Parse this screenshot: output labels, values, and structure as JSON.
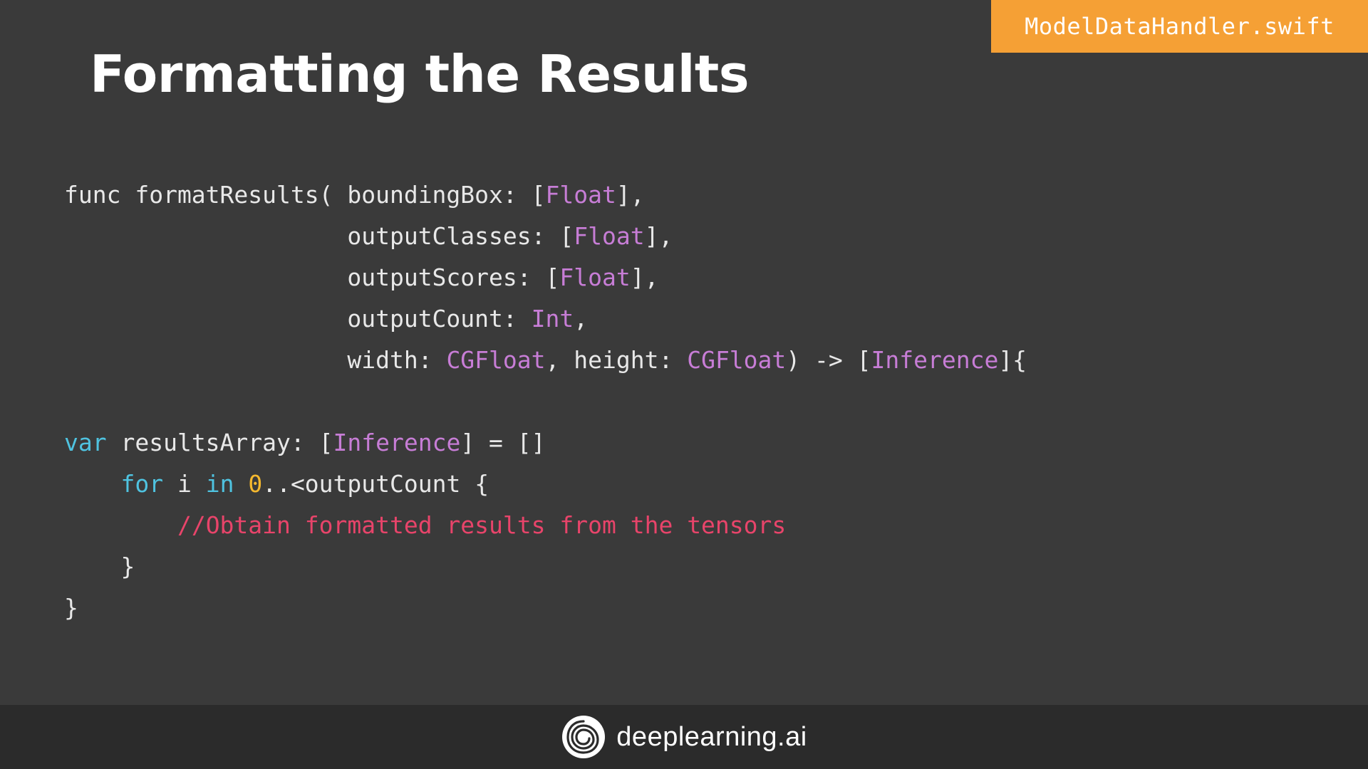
{
  "file_tab": {
    "label": "ModelDataHandler.swift"
  },
  "title": "Formatting the Results",
  "code_lines": [
    [
      {
        "t": "func formatResults( boundingBox: [",
        "c": "pl"
      },
      {
        "t": "Float",
        "c": "ty"
      },
      {
        "t": "],",
        "c": "pl"
      }
    ],
    [
      {
        "t": "                    outputClasses: [",
        "c": "pl"
      },
      {
        "t": "Float",
        "c": "ty"
      },
      {
        "t": "],",
        "c": "pl"
      }
    ],
    [
      {
        "t": "                    outputScores: [",
        "c": "pl"
      },
      {
        "t": "Float",
        "c": "ty"
      },
      {
        "t": "],",
        "c": "pl"
      }
    ],
    [
      {
        "t": "                    outputCount: ",
        "c": "pl"
      },
      {
        "t": "Int",
        "c": "ty"
      },
      {
        "t": ",",
        "c": "pl"
      }
    ],
    [
      {
        "t": "                    width: ",
        "c": "pl"
      },
      {
        "t": "CGFloat",
        "c": "ty"
      },
      {
        "t": ", height: ",
        "c": "pl"
      },
      {
        "t": "CGFloat",
        "c": "ty"
      },
      {
        "t": ") -> [",
        "c": "pl"
      },
      {
        "t": "Inference",
        "c": "ty"
      },
      {
        "t": "]{",
        "c": "pl"
      }
    ],
    [],
    [
      {
        "t": "var",
        "c": "kw"
      },
      {
        "t": " resultsArray: [",
        "c": "pl"
      },
      {
        "t": "Inference",
        "c": "ty"
      },
      {
        "t": "] = []",
        "c": "pl"
      }
    ],
    [
      {
        "t": "    ",
        "c": "pl"
      },
      {
        "t": "for",
        "c": "kw"
      },
      {
        "t": " i ",
        "c": "pl"
      },
      {
        "t": "in",
        "c": "kw"
      },
      {
        "t": " ",
        "c": "pl"
      },
      {
        "t": "0",
        "c": "num"
      },
      {
        "t": "..<outputCount {",
        "c": "pl"
      }
    ],
    [
      {
        "t": "        ",
        "c": "pl"
      },
      {
        "t": "//Obtain formatted results from the tensors",
        "c": "cm"
      }
    ],
    [
      {
        "t": "    }",
        "c": "pl"
      }
    ],
    [
      {
        "t": "}",
        "c": "pl"
      }
    ]
  ],
  "footer": {
    "brand_name": "deeplearning.ai",
    "logo_icon": "deeplearning-logo-icon"
  },
  "colors": {
    "background": "#3a3a3a",
    "footer": "#2b2b2b",
    "file_tab": "#f5a035",
    "keyword": "#4fc3e0",
    "type": "#c77dd6",
    "number": "#f5b82e",
    "comment": "#e8446a"
  }
}
